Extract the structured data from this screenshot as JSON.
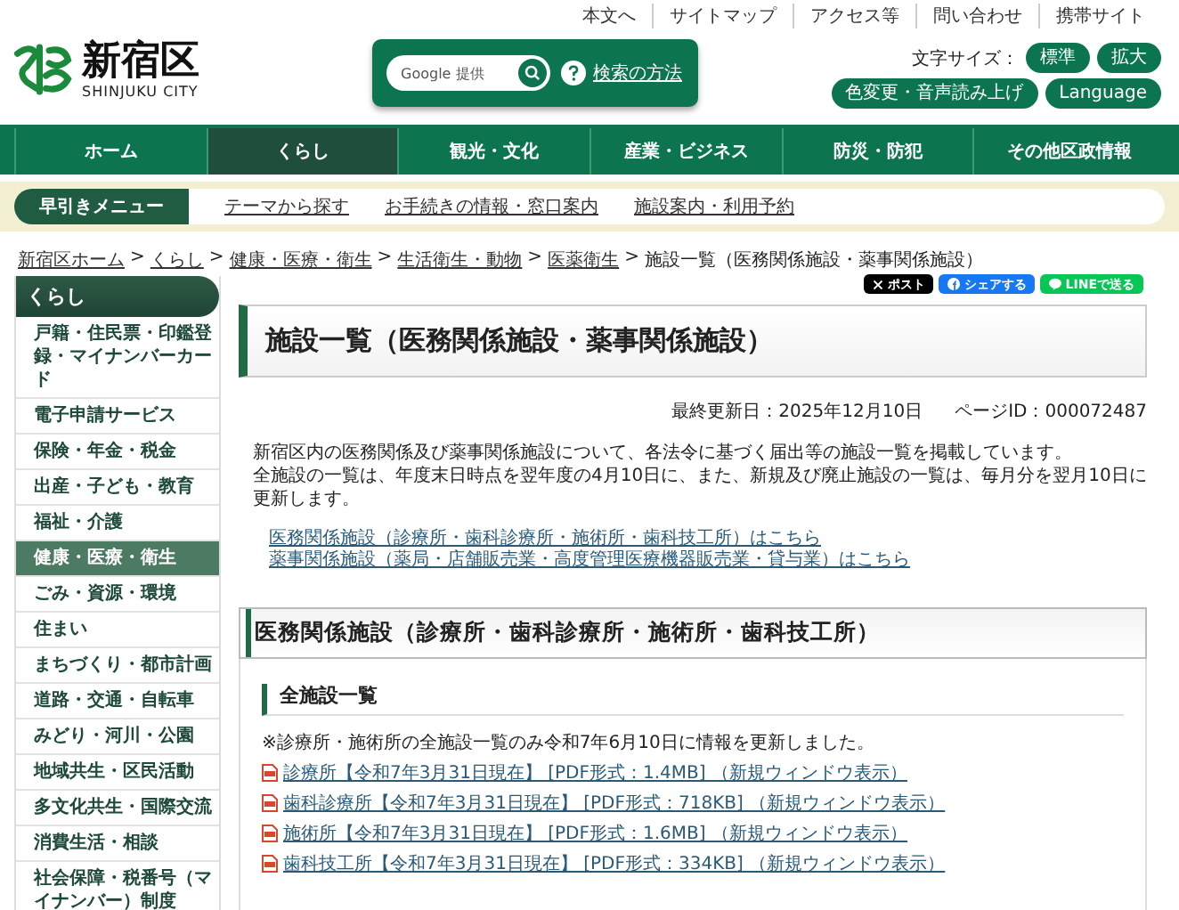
{
  "header": {
    "logo": {
      "name": "新宿区",
      "subtitle": "SHINJUKU CITY"
    },
    "util_links": [
      "本文へ",
      "サイトマップ",
      "アクセス等",
      "問い合わせ",
      "携帯サイト"
    ],
    "search": {
      "placeholder": "Google 提供",
      "help": "検索の方法"
    },
    "font_size": {
      "label": "文字サイズ：",
      "buttons": [
        "標準",
        "拡大"
      ]
    },
    "extra_buttons": [
      "色変更・音声読み上げ",
      "Language"
    ]
  },
  "nav": [
    {
      "label": "ホーム",
      "selected": false
    },
    {
      "label": "くらし",
      "selected": true
    },
    {
      "label": "観光・文化",
      "selected": false
    },
    {
      "label": "産業・ビジネス",
      "selected": false
    },
    {
      "label": "防災・防犯",
      "selected": false
    },
    {
      "label": "その他区政情報",
      "selected": false
    }
  ],
  "quick_menu": {
    "label": "早引きメニュー",
    "links": [
      "テーマから探す",
      "お手続きの情報・窓口案内",
      "施設案内・利用予約"
    ]
  },
  "breadcrumb": {
    "links": [
      "新宿区ホーム",
      "くらし",
      "健康・医療・衛生",
      "生活衛生・動物",
      "医薬衛生"
    ],
    "current": "施設一覧（医務関係施設・薬事関係施設）",
    "separator": ">"
  },
  "share": [
    {
      "kind": "x",
      "label": "ポスト"
    },
    {
      "kind": "facebook",
      "label": "シェアする"
    },
    {
      "kind": "line",
      "label": "LINEで送る"
    }
  ],
  "sidebar": {
    "title": "くらし",
    "items": [
      {
        "label": "戸籍・住民票・印鑑登録・マイナンバーカード",
        "selected": false
      },
      {
        "label": "電子申請サービス",
        "selected": false
      },
      {
        "label": "保険・年金・税金",
        "selected": false
      },
      {
        "label": "出産・子ども・教育",
        "selected": false
      },
      {
        "label": "福祉・介護",
        "selected": false
      },
      {
        "label": "健康・医療・衛生",
        "selected": true
      },
      {
        "label": "ごみ・資源・環境",
        "selected": false
      },
      {
        "label": "住まい",
        "selected": false
      },
      {
        "label": "まちづくり・都市計画",
        "selected": false
      },
      {
        "label": "道路・交通・自転車",
        "selected": false
      },
      {
        "label": "みどり・河川・公園",
        "selected": false
      },
      {
        "label": "地域共生・区民活動",
        "selected": false
      },
      {
        "label": "多文化共生・国際交流",
        "selected": false
      },
      {
        "label": "消費生活・相談",
        "selected": false
      },
      {
        "label": "社会保障・税番号（マイナンバー）制度",
        "selected": false
      }
    ]
  },
  "main": {
    "title": "施設一覧（医務関係施設・薬事関係施設）",
    "updated": "最終更新日：2025年12月10日",
    "page_id": "ページID：000072487",
    "intro": [
      "新宿区内の医務関係及び薬事関係施設について、各法令に基づく届出等の施設一覧を掲載しています。",
      "全施設の一覧は、年度末日時点を翌年度の4月10日に、また、新規及び廃止施設の一覧は、毎月分を翌月10日に更新します。"
    ],
    "links": [
      "医務関係施設（診療所・歯科診療所・施術所・歯科技工所）はこちら",
      "薬事関係施設（薬局・店舗販売業・高度管理医療機器販売業・貸与業）はこちら"
    ],
    "section": {
      "title": "医務関係施設（診療所・歯科診療所・施術所・歯科技工所）",
      "subtitle": "全施設一覧",
      "note": "※診療所・施術所の全施設一覧のみ令和7年6月10日に情報を更新しました。",
      "files": [
        "診療所【令和7年3月31日現在】 [PDF形式：1.4MB] （新規ウィンドウ表示）",
        "歯科診療所【令和7年3月31日現在】 [PDF形式：718KB] （新規ウィンドウ表示）",
        "施術所【令和7年3月31日現在】 [PDF形式：1.6MB] （新規ウィンドウ表示）",
        "歯科技工所【令和7年3月31日現在】 [PDF形式：334KB] （新規ウィンドウ表示）"
      ]
    }
  }
}
